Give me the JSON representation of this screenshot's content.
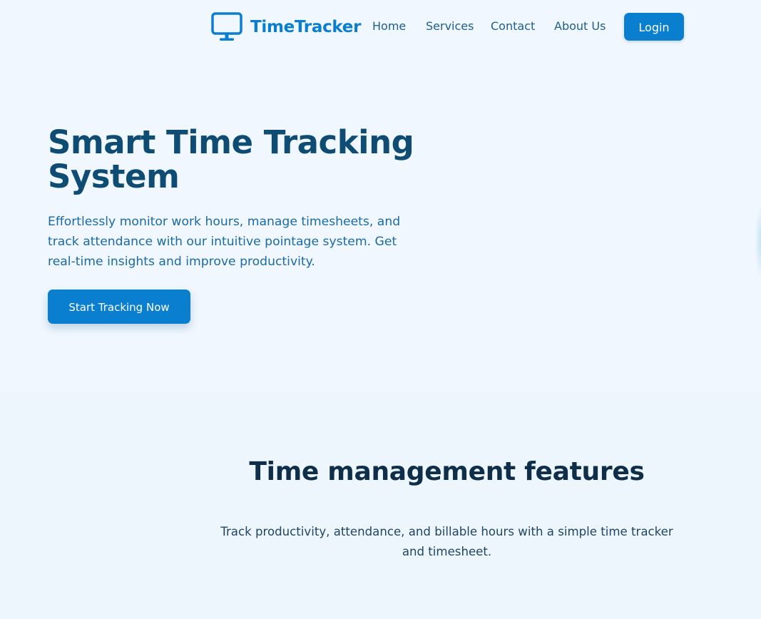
{
  "header": {
    "brand": {
      "name": "TimeTracker",
      "icon": "monitor-icon"
    },
    "nav": [
      {
        "label": "Home"
      },
      {
        "label": "Services"
      },
      {
        "label": "Contact"
      },
      {
        "label": "About Us"
      }
    ],
    "login_label": "Login"
  },
  "hero": {
    "title": "Smart Time Tracking System",
    "description": "Effortlessly monitor work hours, manage timesheets, and track attendance with our intuitive pointage system. Get real-time insights and improve productivity.",
    "cta_label": "Start Tracking Now"
  },
  "features": {
    "title": "Time management features",
    "description": "Track productivity, attendance, and billable hours with a simple time tracker and timesheet."
  },
  "colors": {
    "accent": "#0a7fd0",
    "background": "#f0f7fe",
    "heading": "#0e4c74",
    "nav_text": "#1d5f8f"
  }
}
